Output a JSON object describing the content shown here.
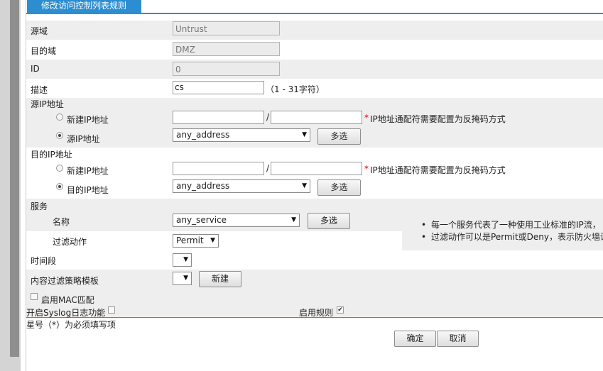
{
  "tab": {
    "title": "修改访问控制列表规则"
  },
  "fields": {
    "source_zone": {
      "label": "源域",
      "value": "Untrust"
    },
    "dest_zone": {
      "label": "目的域",
      "value": "DMZ"
    },
    "id": {
      "label": "ID",
      "value": "0"
    },
    "description": {
      "label": "描述",
      "value": "cs",
      "hint": "（1 - 31字符）"
    }
  },
  "source_ip": {
    "section_label": "源IP地址",
    "new_option": "新建IP地址",
    "existing_option": "源IP地址",
    "slash": "/",
    "star": "*",
    "hint": "IP地址通配符需要配置为反掩码方式",
    "selected": "any_address",
    "multi_label": "多选"
  },
  "dest_ip": {
    "section_label": "目的IP地址",
    "new_option": "新建IP地址",
    "existing_option": "目的IP地址",
    "slash": "/",
    "star": "*",
    "hint": "IP地址通配符需要配置为反掩码方式",
    "selected": "any_address",
    "multi_label": "多选"
  },
  "service": {
    "section_label": "服务",
    "name_label": "名称",
    "selected": "any_service",
    "multi_label": "多选",
    "filter_label": "过滤动作",
    "filter_value": "Permit"
  },
  "notes": [
    "每一个服务代表了一种使用工业标准的IP流，",
    "过滤动作可以是Permit或Deny，表示防火墙设"
  ],
  "time_range": {
    "label": "时间段",
    "value": ""
  },
  "content_filter": {
    "label": "内容过滤策略模板",
    "value": "",
    "new_label": "新建"
  },
  "mac_match": {
    "label": "启用MAC匹配",
    "checked": false
  },
  "syslog": {
    "label": "开启Syslog日志功能",
    "checked": false
  },
  "enable_rule": {
    "label": "启用规则",
    "checked": true
  },
  "required_note": "星号（*）为必须填写项",
  "actions": {
    "ok": "确定",
    "cancel": "取消"
  },
  "icons": {
    "dropdown": "dropdown-arrow-icon",
    "check": "check-icon"
  },
  "colors": {
    "accent": "#2c8ed1",
    "row_shade": "#eeeeee",
    "required": "#dd0000"
  }
}
